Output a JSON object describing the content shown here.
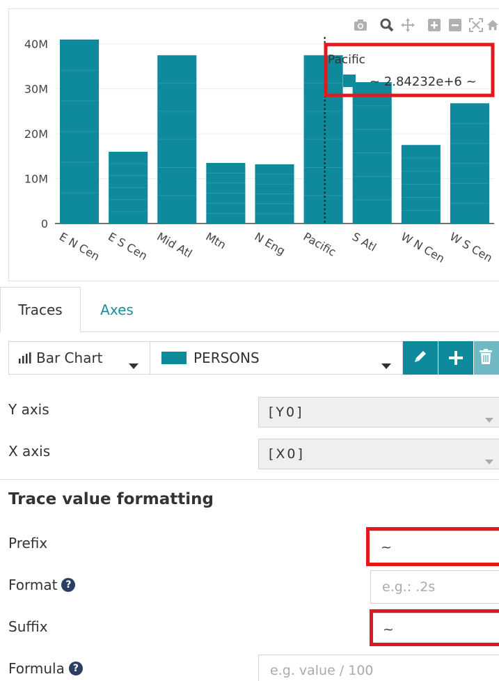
{
  "chart_data": {
    "type": "bar",
    "categories": [
      "E N Cen",
      "E S Cen",
      "Mid Atl",
      "Mtn",
      "N Eng",
      "Pacific",
      "S Atl",
      "W N Cen",
      "W S Cen"
    ],
    "values": [
      41000000,
      16000000,
      37500000,
      13500000,
      13200000,
      37500000,
      31500000,
      17500000,
      26800000
    ],
    "y_ticks": [
      "0",
      "10M",
      "20M",
      "30M",
      "40M"
    ],
    "ylim": [
      0,
      45000000
    ],
    "bar_color": "#0e8a9c",
    "hover_category": "Pacific",
    "hover_label": {
      "title": "Pacific",
      "value_text": "~ 2.84232e+6 ~"
    }
  },
  "modebar": {
    "icons": [
      "camera-icon",
      "zoom-icon",
      "pan-icon",
      "zoom-in-icon",
      "zoom-out-icon",
      "autoscale-icon",
      "home-icon"
    ]
  },
  "tabs": [
    {
      "label": "Traces",
      "active": true
    },
    {
      "label": "Axes",
      "active": false
    }
  ],
  "trace_toolbar": {
    "chart_type_label": "Bar Chart",
    "trace_name": "PERSONS",
    "trace_color": "#0e8a9c"
  },
  "axes": {
    "y_label": "Y axis",
    "y_value": "[Y0]",
    "x_label": "X axis",
    "x_value": "[X0]"
  },
  "formatting": {
    "title": "Trace value formatting",
    "prefix_label": "Prefix",
    "prefix_value": "~",
    "format_label": "Format",
    "format_placeholder": "e.g.: .2s",
    "suffix_label": "Suffix",
    "suffix_value": "~",
    "formula_label": "Formula",
    "formula_placeholder": "e.g. value / 100"
  },
  "colors": {
    "accent": "#0e8a9c",
    "highlight": "#e31a1c",
    "tab_link": "#1a8ea0"
  }
}
